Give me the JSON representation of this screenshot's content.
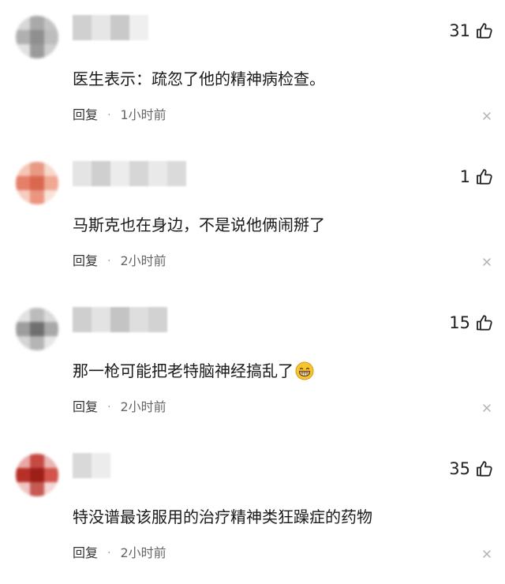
{
  "comments": [
    {
      "likes": "31",
      "text": "医生表示：疏忽了他的精神病检查。",
      "reply_label": "回复",
      "separator": "·",
      "time": "1小时前",
      "has_emoji": false,
      "avatar_palette": [
        "#d8d8d8",
        "#a9a9a9",
        "#c4c4c4",
        "#b0b0b0",
        "#8f8f8f",
        "#bdbdbd",
        "#e2e2e2",
        "#9b9b9b",
        "#cfcfcf"
      ],
      "username_palette": [
        "#d0d0d0",
        "#e6e6e6",
        "#c9c9c9",
        "#efefef"
      ]
    },
    {
      "likes": "1",
      "text": "马斯克也在身边，不是说他俩闹掰了",
      "reply_label": "回复",
      "separator": "·",
      "time": "2小时前",
      "has_emoji": false,
      "avatar_palette": [
        "#f4c6b6",
        "#e89a86",
        "#f7d8cc",
        "#e57f68",
        "#d9674f",
        "#f0a893",
        "#f6cdbf",
        "#ec9580",
        "#f9e2d9"
      ],
      "username_palette": [
        "#e4e4e4",
        "#cfcfcf",
        "#ececec",
        "#d6d6d6",
        "#e9e9e9",
        "#dadada"
      ]
    },
    {
      "likes": "15",
      "text": "那一枪可能把老特脑神经搞乱了",
      "reply_label": "回复",
      "separator": "·",
      "time": "2小时前",
      "has_emoji": true,
      "avatar_palette": [
        "#e2e2e2",
        "#bcbcbc",
        "#dadada",
        "#9e9e9e",
        "#6f6f6f",
        "#a8a8a8",
        "#d4d4d4",
        "#b5b5b5",
        "#e6e6e6"
      ],
      "username_palette": [
        "#cfcfcf",
        "#e3e3e3",
        "#c4c4c4",
        "#dedede",
        "#d2d2d2"
      ]
    },
    {
      "likes": "35",
      "text": "特没谱最该服用的治疗精神类狂躁症的药物",
      "reply_label": "回复",
      "separator": "·",
      "time": "2小时前",
      "has_emoji": false,
      "avatar_palette": [
        "#e8a9a6",
        "#c64a44",
        "#eab5b2",
        "#b73028",
        "#9e1f18",
        "#d2544c",
        "#f0c6c3",
        "#c65a53",
        "#f4d6d4"
      ],
      "username_palette": [
        "#d9d9d9",
        "#ececec"
      ]
    }
  ],
  "icons": {
    "like": "thumbs-up-icon",
    "close": "close-icon",
    "emoji": "grinning-emoji-icon"
  },
  "colors": {
    "text": "#1a1a1a",
    "meta": "#666666",
    "icon": "#222222",
    "close": "#b0b0b0",
    "emoji_face": "#f7c531"
  }
}
